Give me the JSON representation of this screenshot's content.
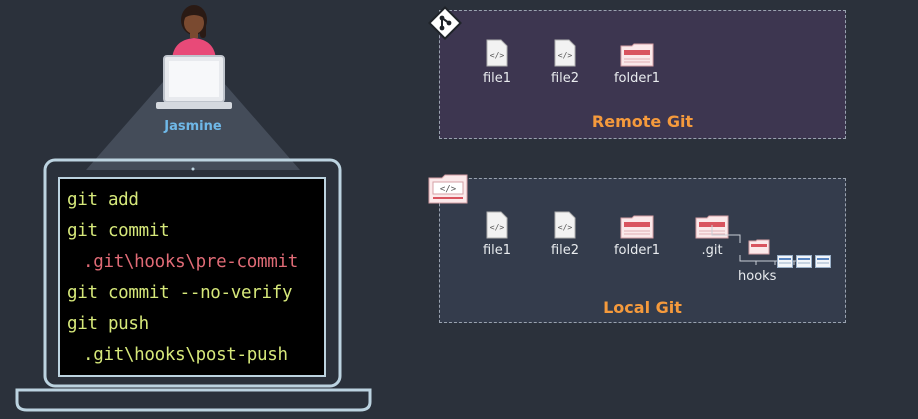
{
  "user": {
    "name": "Jasmine"
  },
  "terminal": {
    "lines": [
      "git add",
      "git commit",
      ".git\\hooks\\pre-commit",
      "git commit --no-verify",
      "git push",
      ".git\\hooks\\post-push"
    ]
  },
  "remote": {
    "title": "Remote Git",
    "items": [
      "file1",
      "file2",
      "folder1"
    ]
  },
  "local": {
    "title": "Local Git",
    "items": [
      "file1",
      "file2",
      "folder1",
      ".git"
    ],
    "hooks_label": "hooks"
  },
  "icons": [
    "git-logo-icon",
    "file-icon",
    "folder-icon",
    "code-folder-icon",
    "person-icon",
    "laptop-icon"
  ],
  "colors": {
    "accent": "#f59a3c",
    "command": "#d6e87a",
    "hook_path": "#e06b76",
    "name": "#6fb8e8"
  }
}
